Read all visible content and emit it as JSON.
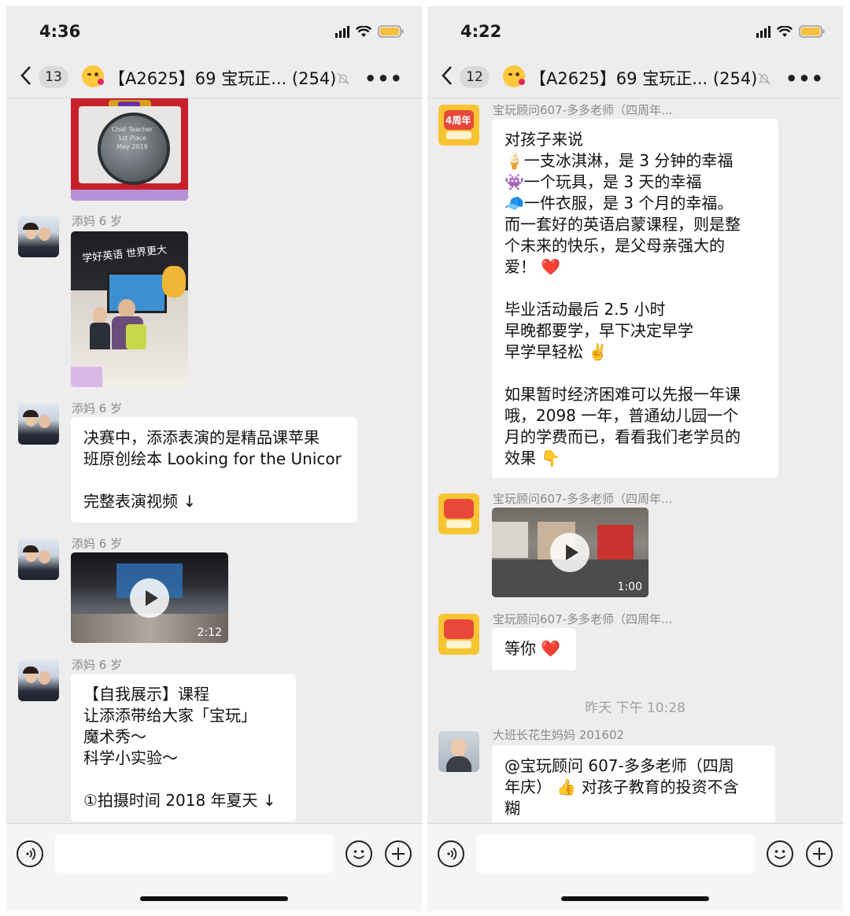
{
  "left": {
    "status": {
      "time": "4:36"
    },
    "nav": {
      "unread": "13",
      "title": "【A2625】69 宝玩正... (254)"
    },
    "messages": {
      "m1_sender": "添妈 6 岁",
      "m2_sender": "添妈 6 岁",
      "m2_text": "决赛中，添添表演的是精品课苹果\n班原创绘本 Looking for the Unicor\n\n完整表演视频 ↓",
      "m3_sender": "添妈 6 岁",
      "m3_duration": "2:12",
      "m4_sender": "添妈 6 岁",
      "m4_text": "【自我展示】课程\n让添添带给大家「宝玩」\n魔术秀～\n科学小实验～\n\n①拍摄时间 2018 年夏天 ↓"
    },
    "images": {
      "medal_text": "Chat Teacher\n1st Place\nMay 2019",
      "classroom_banner": "学好英语  世界更大"
    }
  },
  "right": {
    "status": {
      "time": "4:22"
    },
    "nav": {
      "unread": "12",
      "title": "【A2625】69 宝玩正... (254)"
    },
    "messages": {
      "r1_sender": "宝玩顾问607-多多老师（四周年...",
      "r1_text": "对孩子来说\n🍦一支冰淇淋，是 3 分钟的幸福\n👾一个玩具，是 3 天的幸福\n🧢一件衣服，是 3 个月的幸福。\n而一套好的英语启蒙课程，则是整\n个未来的快乐，是父母亲强大的\n爱！ ❤️\n\n毕业活动最后 2.5 小时\n早晚都要学，早下决定早学\n早学早轻松 ✌️\n\n如果暂时经济困难可以先报一年课\n哦，2098 一年，普通幼儿园一个\n月的学费而已，看看我们老学员的\n效果 👇",
      "r2_sender": "宝玩顾问607-多多老师（四周年...",
      "r2_duration": "1:00",
      "r3_sender": "宝玩顾问607-多多老师（四周年...",
      "r3_text": "等你 ❤️",
      "timestamp": "昨天 下午 10:28",
      "r4_sender": "大班长花生妈妈 201602",
      "r4_text": "@宝玩顾问 607-多多老师（四周\n年庆） 👍 对孩子教育的投资不含\n糊"
    },
    "images": {
      "logo_text": "4周年"
    }
  },
  "icons": [
    "back-icon",
    "mute-icon",
    "more-icon",
    "voice-icon",
    "emoji-icon",
    "plus-icon",
    "play-icon",
    "wifi-icon",
    "battery-icon",
    "signal-icon"
  ],
  "colors": {
    "background": "#ededed",
    "bubble": "#ffffff",
    "heart": "#e0245e"
  }
}
